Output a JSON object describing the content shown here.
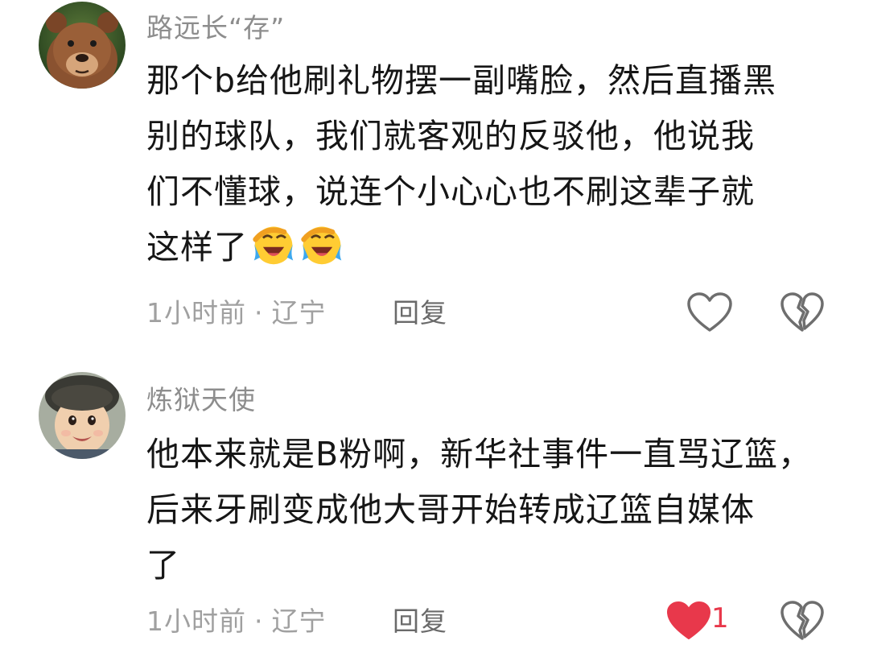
{
  "comments": [
    {
      "author": "路远长“存”",
      "lines": [
        "那个b给他刷礼物摆一副嘴脸，然后直播黑",
        "别的球队，我们就客观的反驳他，他说我",
        "们不懂球，说连个小心心也不刷这辈子就",
        "这样了"
      ],
      "emoji": [
        "crying-laughing-emoji",
        "crying-laughing-emoji"
      ],
      "time": "1小时前",
      "separator": "·",
      "location": "辽宁",
      "reply_label": "回复",
      "liked": false,
      "like_count": ""
    },
    {
      "author": "炼狱天使",
      "lines": [
        "他本来就是B粉啊，新华社事件一直骂辽篮，",
        "后来牙刷变成他大哥开始转成辽篮自媒体",
        "了"
      ],
      "time": "1小时前",
      "separator": "·",
      "location": "辽宁",
      "reply_label": "回复",
      "liked": true,
      "like_count": "1"
    }
  ],
  "colors": {
    "author": "#8d8d8d",
    "meta": "#a0a0a0",
    "like_active": "#e8384b",
    "icon_stroke": "#6e6e6e"
  }
}
